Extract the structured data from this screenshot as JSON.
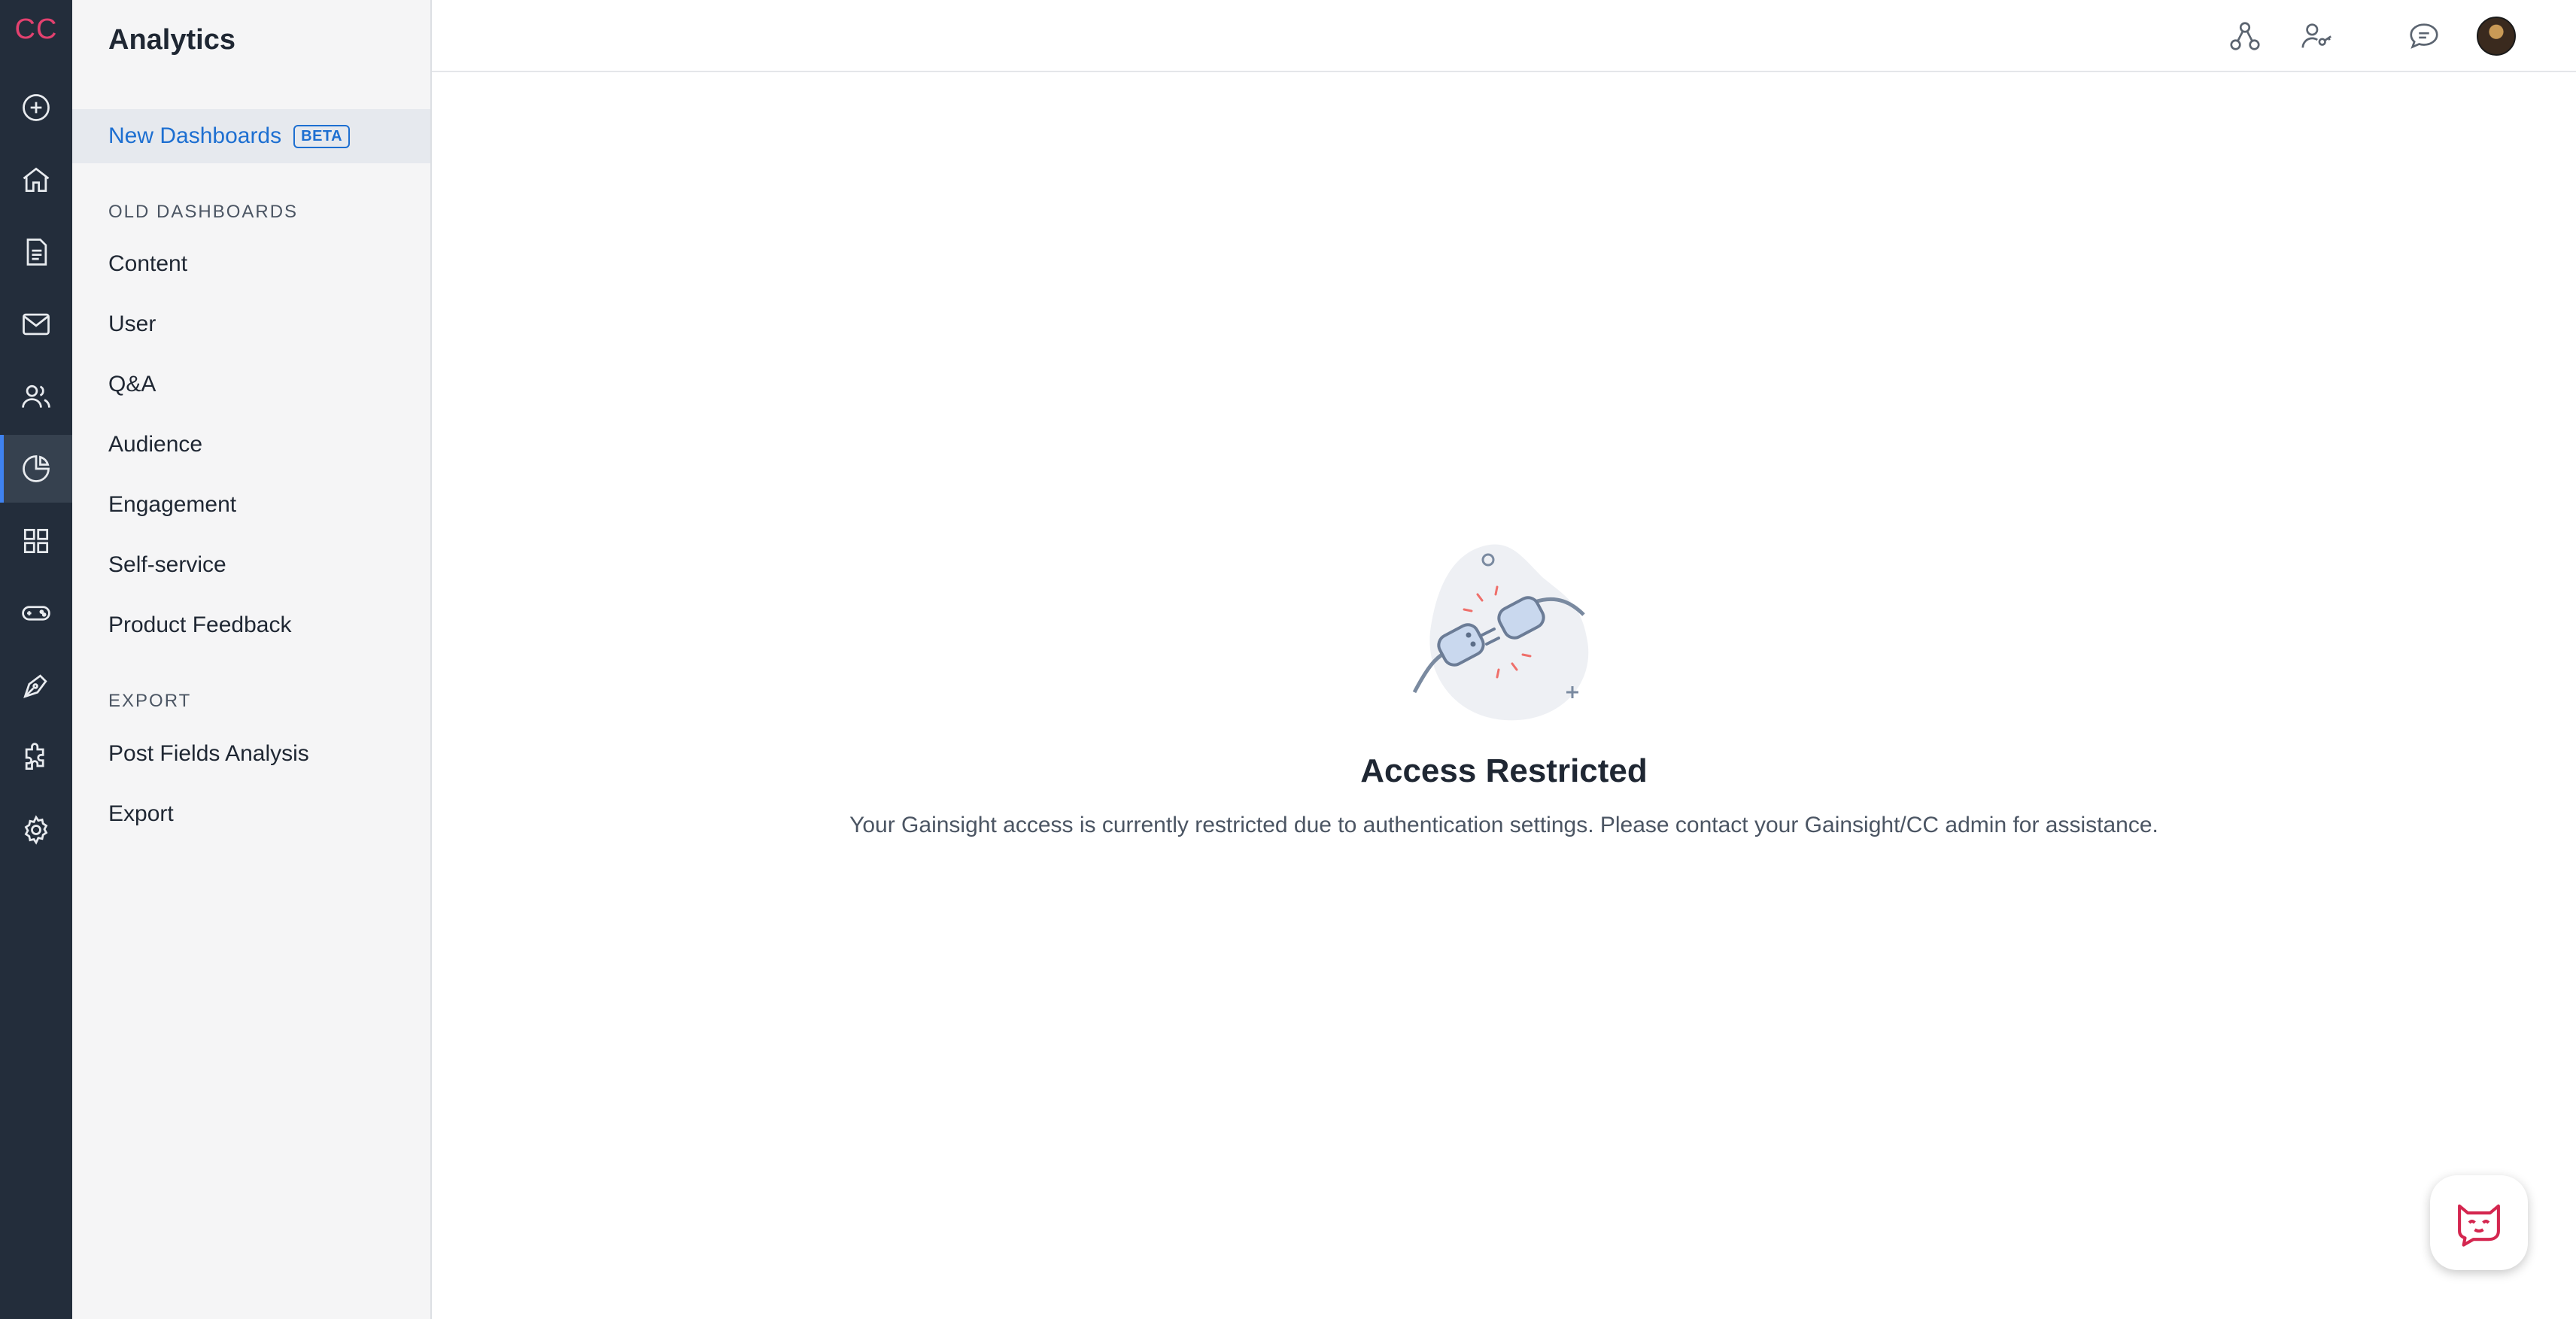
{
  "rail": {
    "logo": "CC",
    "items": [
      {
        "icon": "plus-circle-icon",
        "active": false
      },
      {
        "icon": "home-icon",
        "active": false
      },
      {
        "icon": "document-icon",
        "active": false
      },
      {
        "icon": "mail-icon",
        "active": false
      },
      {
        "icon": "users-icon",
        "active": false
      },
      {
        "icon": "pie-chart-icon",
        "active": true
      },
      {
        "icon": "grid-icon",
        "active": false
      },
      {
        "icon": "gamepad-icon",
        "active": false
      },
      {
        "icon": "pen-nib-icon",
        "active": false
      },
      {
        "icon": "puzzle-icon",
        "active": false
      },
      {
        "icon": "gear-icon",
        "active": false
      }
    ]
  },
  "sidebar": {
    "title": "Analytics",
    "active_item": {
      "label": "New Dashboards",
      "badge": "BETA"
    },
    "sections": [
      {
        "heading": "OLD DASHBOARDS",
        "items": [
          "Content",
          "User",
          "Q&A",
          "Audience",
          "Engagement",
          "Self-service",
          "Product Feedback"
        ]
      },
      {
        "heading": "EXPORT",
        "items": [
          "Post Fields Analysis",
          "Export"
        ]
      }
    ]
  },
  "topbar": {
    "icons": [
      "hierarchy-icon",
      "user-key-icon",
      "chat-icon",
      "avatar"
    ]
  },
  "main": {
    "title": "Access Restricted",
    "message": "Your Gainsight access is currently restricted due to authentication settings. Please contact your Gainsight/CC admin for assistance."
  },
  "colors": {
    "rail_bg": "#232d3b",
    "logo": "#e3416f",
    "accent": "#1d6fd1",
    "active_rail_indicator": "#3f82f0",
    "chat_icon": "#d4264f"
  }
}
